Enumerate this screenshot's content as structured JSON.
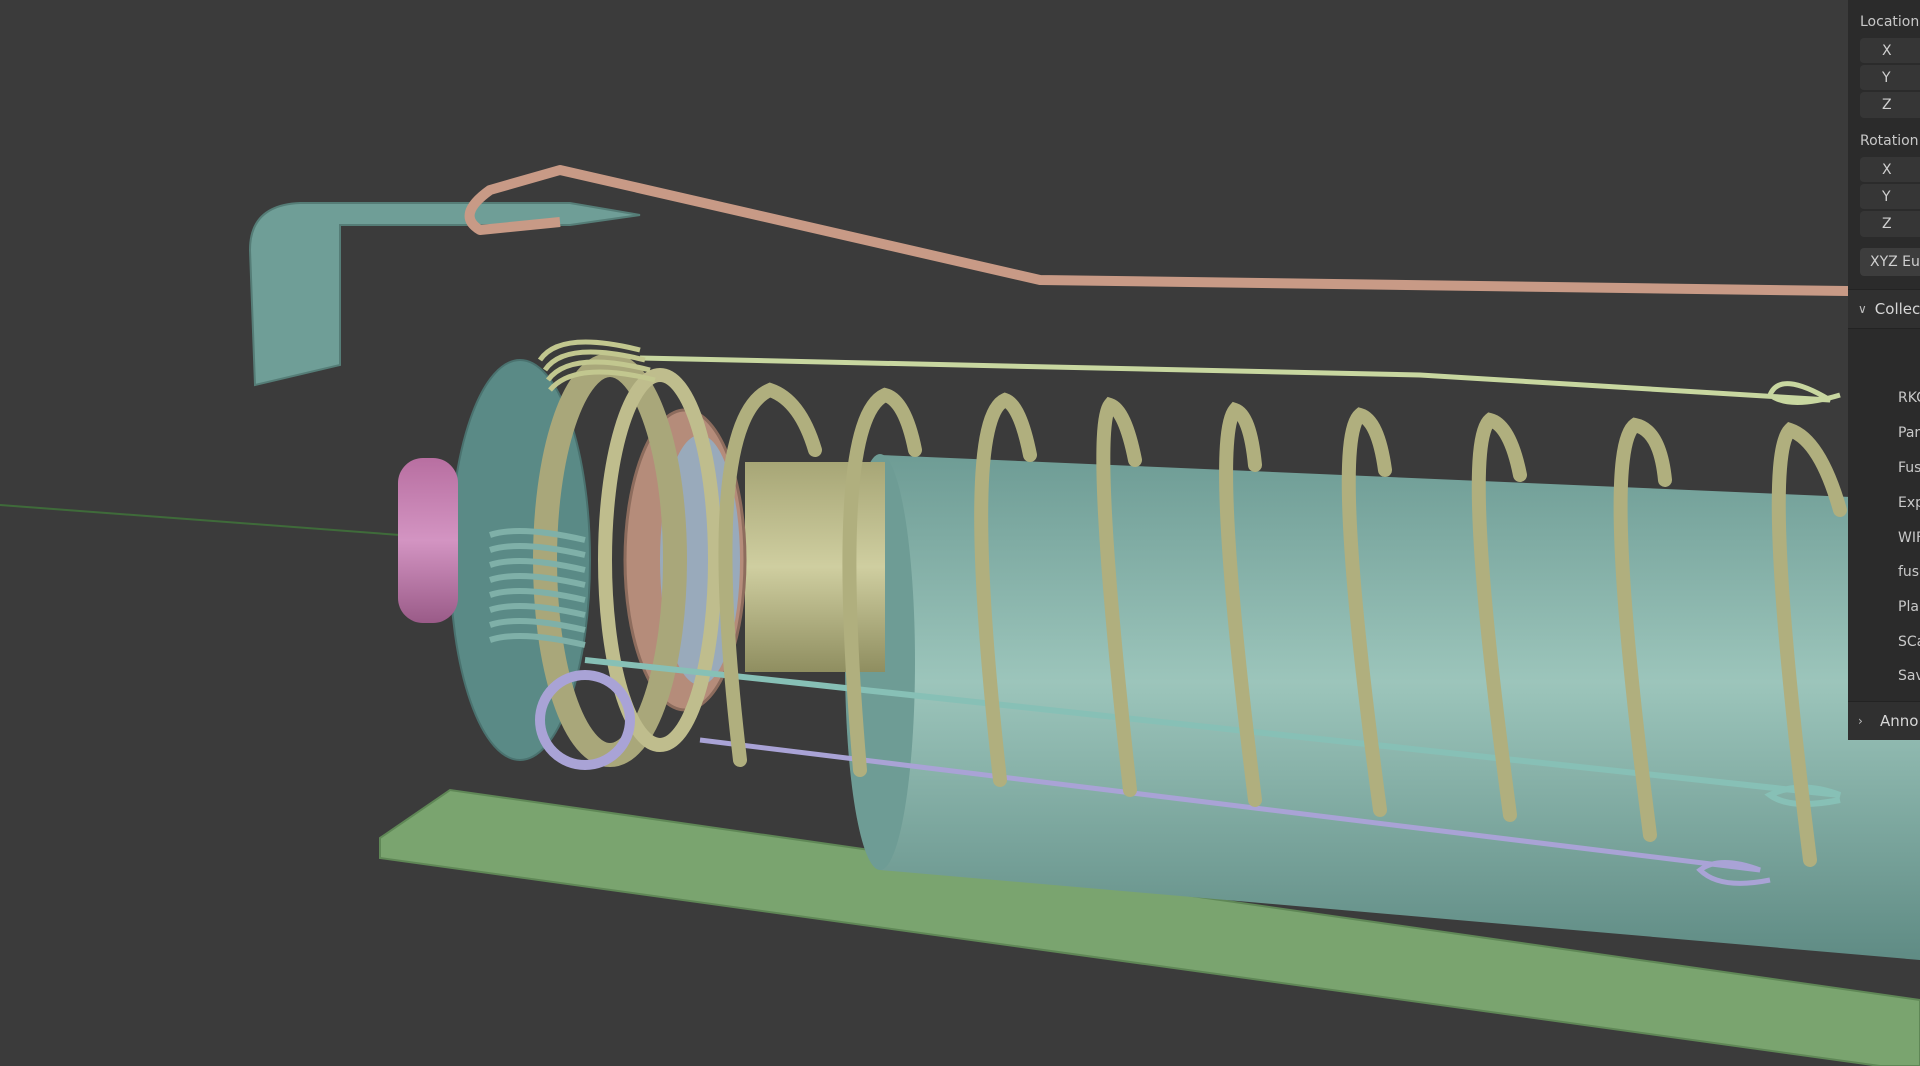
{
  "sidebar": {
    "location_label": "Location",
    "location_axes": [
      "X",
      "Y",
      "Z"
    ],
    "rotation_label": "Rotation:",
    "rotation_axes": [
      "X",
      "Y",
      "Z"
    ],
    "rotation_mode": "XYZ Eu",
    "collections_label": "Collec",
    "collection_items": [
      "RKC",
      "Par",
      "Fuse",
      "Exp",
      "WIF",
      "fuse_",
      "Pla",
      "SCa",
      "Sav"
    ],
    "annotations_label": "Anno"
  },
  "colors": {
    "background": "#3b3b3b",
    "teal": "#7fb0a8",
    "copper": "#c89a86",
    "olive": "#b7b88a",
    "green": "#7fa878",
    "lilac": "#a9a3d6",
    "pink": "#c77fb0"
  }
}
